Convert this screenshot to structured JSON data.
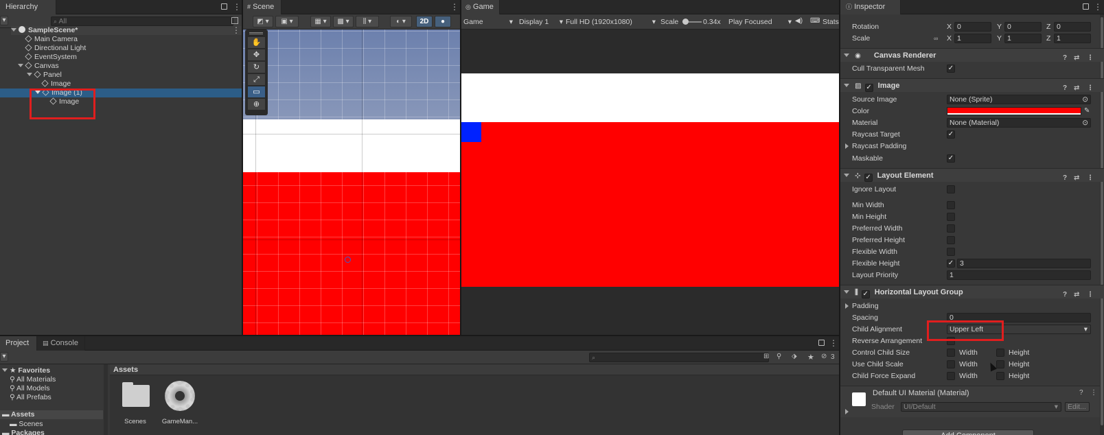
{
  "hierarchy": {
    "tab_label": "Hierarchy",
    "search_placeholder": "All",
    "scene_name": "SampleScene*",
    "items": [
      {
        "label": "Main Camera"
      },
      {
        "label": "Directional Light"
      },
      {
        "label": "EventSystem"
      },
      {
        "label": "Canvas"
      },
      {
        "label": "Panel"
      },
      {
        "label": "Image"
      },
      {
        "label": "Image (1)"
      },
      {
        "label": "Image"
      }
    ]
  },
  "scene": {
    "tab_label": "Scene",
    "mode_2d": "2D"
  },
  "game": {
    "tab_label": "Game",
    "view_select": "Game",
    "display": "Display 1",
    "resolution": "Full HD (1920x1080)",
    "scale_label": "Scale",
    "scale_value": "0.34x",
    "play_mode": "Play Focused",
    "stats": "Stats"
  },
  "inspector": {
    "tab_label": "Inspector",
    "transform": {
      "rotation_label": "Rotation",
      "rotation": {
        "x": "0",
        "y": "0",
        "z": "0"
      },
      "scale_label": "Scale",
      "scale": {
        "x": "1",
        "y": "1",
        "z": "1"
      },
      "axis_x": "X",
      "axis_y": "Y",
      "axis_z": "Z"
    },
    "canvas_renderer": {
      "title": "Canvas Renderer",
      "cull_label": "Cull Transparent Mesh",
      "cull_checked": "✓"
    },
    "image": {
      "title": "Image",
      "source_image_label": "Source Image",
      "source_image_value": "None (Sprite)",
      "color_label": "Color",
      "color_value": "#ff0000",
      "material_label": "Material",
      "material_value": "None (Material)",
      "raycast_target_label": "Raycast Target",
      "raycast_target_checked": "✓",
      "raycast_padding_label": "Raycast Padding",
      "maskable_label": "Maskable",
      "maskable_checked": "✓"
    },
    "layout_element": {
      "title": "Layout Element",
      "ignore_layout": "Ignore Layout",
      "min_width": "Min Width",
      "min_height": "Min Height",
      "preferred_width": "Preferred Width",
      "preferred_height": "Preferred Height",
      "flexible_width": "Flexible Width",
      "flexible_height": "Flexible Height",
      "flexible_height_checked": "✓",
      "flexible_height_value": "3",
      "layout_priority": "Layout Priority",
      "layout_priority_value": "1"
    },
    "horizontal_layout_group": {
      "title": "Horizontal Layout Group",
      "padding": "Padding",
      "spacing_label": "Spacing",
      "spacing_value": "0",
      "child_alignment_label": "Child Alignment",
      "child_alignment_value": "Upper Left",
      "reverse_label": "Reverse Arrangement",
      "control_child_size": "Control Child Size",
      "use_child_scale": "Use Child Scale",
      "child_force_expand": "Child Force Expand",
      "width": "Width",
      "height": "Height"
    },
    "material": {
      "name": "Default UI Material (Material)",
      "shader_label": "Shader",
      "shader_value": "UI/Default",
      "edit_label": "Edit..."
    },
    "add_component": "Add Component"
  },
  "project": {
    "tab_project": "Project",
    "tab_console": "Console",
    "count": "3",
    "favorites": "Favorites",
    "fav_items": [
      "All Materials",
      "All Models",
      "All Prefabs"
    ],
    "assets": "Assets",
    "scenes": "Scenes",
    "packages": "Packages",
    "breadcrumb": "Assets",
    "files": [
      {
        "label": "Scenes",
        "icon": "folder-icon"
      },
      {
        "label": "GameMan...",
        "icon": "gear-icon"
      }
    ]
  },
  "colors": {
    "red": "#ff0000",
    "blue": "#0022ff",
    "white": "#ffffff",
    "highlight": "#2c5d87",
    "annotation": "#e01e1e"
  }
}
